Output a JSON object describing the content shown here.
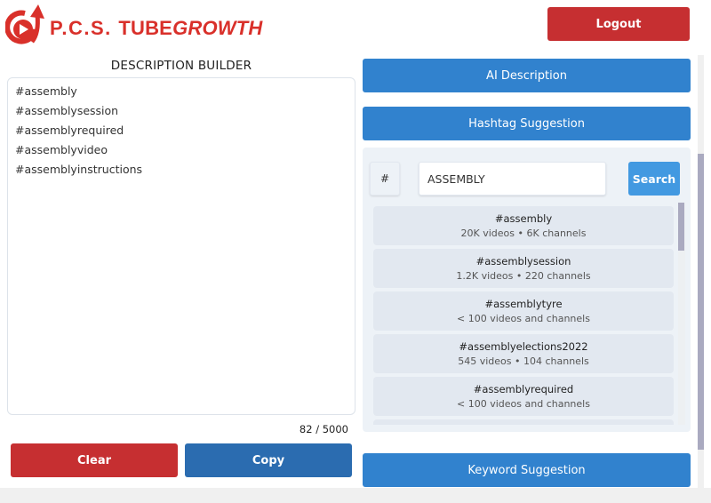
{
  "header": {
    "logo": {
      "prefix": "P.C.S. ",
      "tube": "TUBE",
      "growth": "GROWTH",
      "icon": "play-arrow-logo-icon",
      "brand_color": "#d9302a"
    },
    "logout_label": "Logout"
  },
  "builder": {
    "title": "DESCRIPTION BUILDER",
    "content": "#assembly\n#assemblysession\n#assemblyrequired\n#assemblyvideo\n#assemblyinstructions",
    "char_count": "82 / 5000",
    "clear_label": "Clear",
    "copy_label": "Copy"
  },
  "tools": {
    "ai_description_label": "AI Description",
    "hashtag_suggestion_label": "Hashtag Suggestion",
    "keyword_suggestion_label": "Keyword Suggestion"
  },
  "hashtag_search": {
    "prefix": "#",
    "query": "ASSEMBLY",
    "search_label": "Search",
    "results": [
      {
        "tag": "#assembly",
        "stats": "20K videos • 6K channels"
      },
      {
        "tag": "#assemblysession",
        "stats": "1.2K videos • 220 channels"
      },
      {
        "tag": "#assemblytyre",
        "stats": "< 100 videos and channels"
      },
      {
        "tag": "#assemblyelections2022",
        "stats": "545 videos • 104 channels"
      },
      {
        "tag": "#assemblyrequired",
        "stats": "< 100 videos and channels"
      }
    ]
  },
  "colors": {
    "danger": "#c62f31",
    "primary": "#3182ce",
    "copy": "#2b6cb0",
    "search": "#4299e1"
  }
}
